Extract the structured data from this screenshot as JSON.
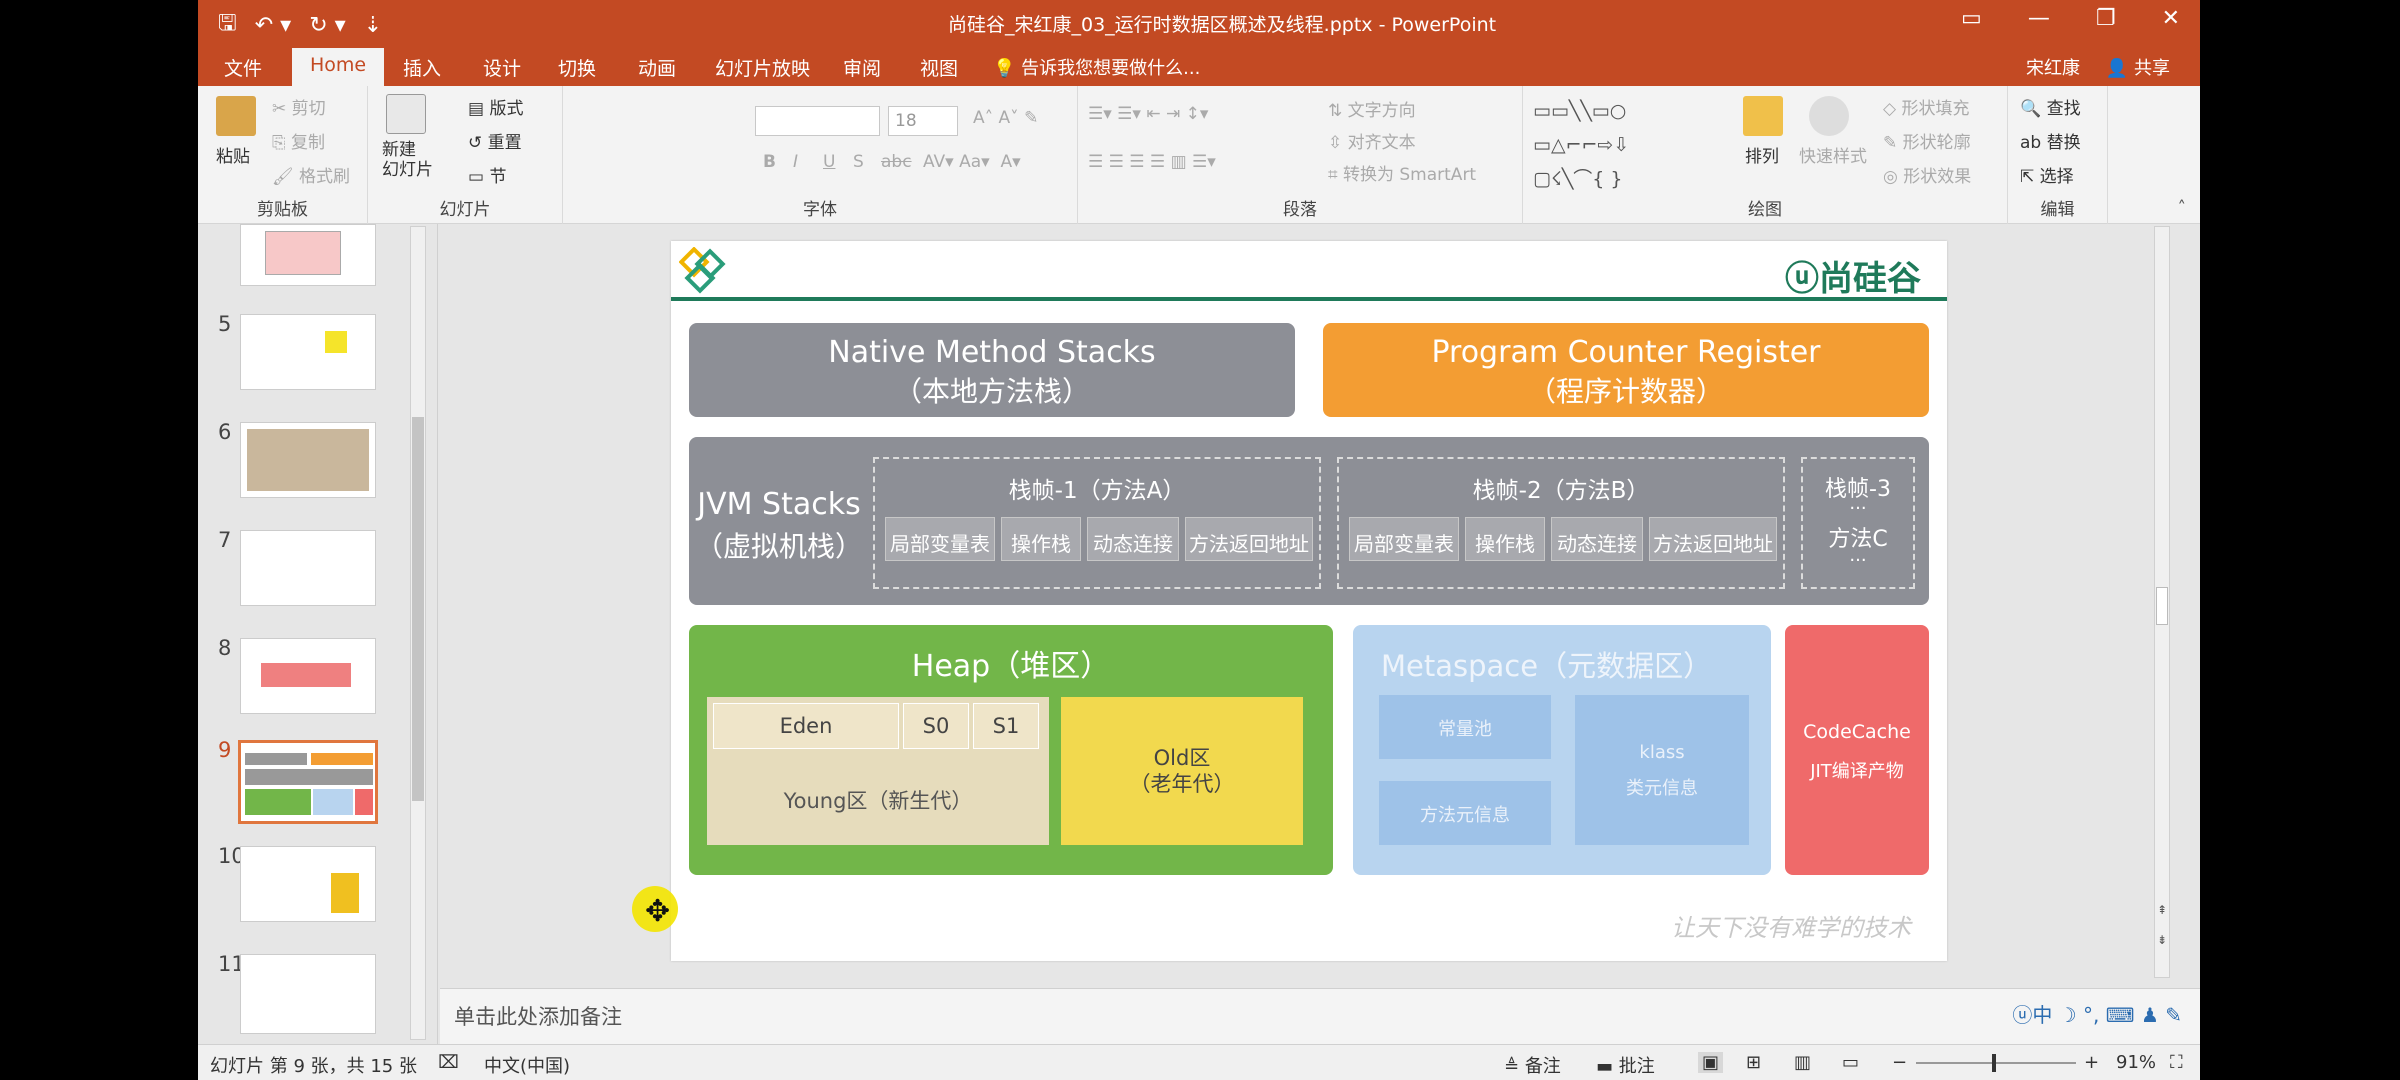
{
  "window": {
    "title": "尚硅谷_宋红康_03_运行时数据区概述及线程.pptx - PowerPoint",
    "controls": [
      "▭",
      "—",
      "❐",
      "✕"
    ]
  },
  "tabs": {
    "file": "文件",
    "home": "Home",
    "insert": "插入",
    "design": "设计",
    "transitions": "切换",
    "animations": "动画",
    "slideshow": "幻灯片放映",
    "review": "审阅",
    "view": "视图",
    "tell_me": "告诉我您想要做什么...",
    "user": "宋红康",
    "share": "共享"
  },
  "ribbon": {
    "clipboard": {
      "label": "剪贴板",
      "paste": "粘贴",
      "cut": "剪切",
      "copy": "复制",
      "format_painter": "格式刷"
    },
    "slides": {
      "label": "幻灯片",
      "new_slide": "新建\n幻灯片",
      "layout": "版式",
      "reset": "重置",
      "section": "节"
    },
    "font": {
      "label": "字体",
      "font_size": "18",
      "bold": "B",
      "italic": "I",
      "underline": "U",
      "shadow": "S",
      "strike": "abc"
    },
    "paragraph": {
      "label": "段落",
      "text_direction": "文字方向",
      "align_text": "对齐文本",
      "smartart": "转换为 SmartArt"
    },
    "drawing": {
      "label": "绘图",
      "arrange": "排列",
      "quick_styles": "快速样式",
      "shape_fill": "形状填充",
      "shape_outline": "形状轮廓",
      "shape_effects": "形状效果"
    },
    "editing": {
      "label": "编辑",
      "find": "查找",
      "replace": "替换",
      "select": "选择"
    }
  },
  "thumbnails": [
    {
      "num": "5",
      "selected": false
    },
    {
      "num": "6",
      "selected": false
    },
    {
      "num": "7",
      "selected": false
    },
    {
      "num": "8",
      "selected": false
    },
    {
      "num": "9",
      "selected": true
    },
    {
      "num": "10",
      "selected": false
    },
    {
      "num": "11",
      "selected": false
    }
  ],
  "slide": {
    "brand": "尚硅谷",
    "native_stacks": {
      "en": "Native Method Stacks",
      "zh": "（本地方法栈）"
    },
    "pc_register": {
      "en": "Program Counter Register",
      "zh": "（程序计数器）"
    },
    "jvm_stacks": {
      "en": "JVM Stacks",
      "zh": "（虚拟机栈）"
    },
    "frame1": {
      "title": "栈帧-1（方法A）",
      "cells": [
        "局部变量表",
        "操作栈",
        "动态连接",
        "方法返回地址"
      ]
    },
    "frame2": {
      "title": "栈帧-2（方法B）",
      "cells": [
        "局部变量表",
        "操作栈",
        "动态连接",
        "方法返回地址"
      ]
    },
    "frame3": {
      "title": "栈帧-3",
      "dots1": "...",
      "method": "方法C",
      "dots2": "..."
    },
    "heap": {
      "title": "Heap（堆区）",
      "eden": "Eden",
      "s0": "S0",
      "s1": "S1",
      "young": "Young区（新生代）",
      "old": "Old区\n（老年代）"
    },
    "metaspace": {
      "title": "Metaspace（元数据区）",
      "constant_pool": "常量池",
      "method_meta": "方法元信息",
      "klass": "klass\n类元信息"
    },
    "codecache": {
      "line1": "CodeCache",
      "line2": "JIT编译产物"
    },
    "watermark": "让天下没有难学的技术"
  },
  "notes": {
    "placeholder": "单击此处添加备注",
    "ime": "ⓤ中 ☽ °, ⌨ ♟ ✎"
  },
  "status": {
    "slide_info": "幻灯片 第 9 张，共 15 张",
    "language": "中文(中国)",
    "notes_btn": "备注",
    "comments_btn": "批注",
    "zoom": "91%",
    "zoom_fraction": 0.55
  }
}
